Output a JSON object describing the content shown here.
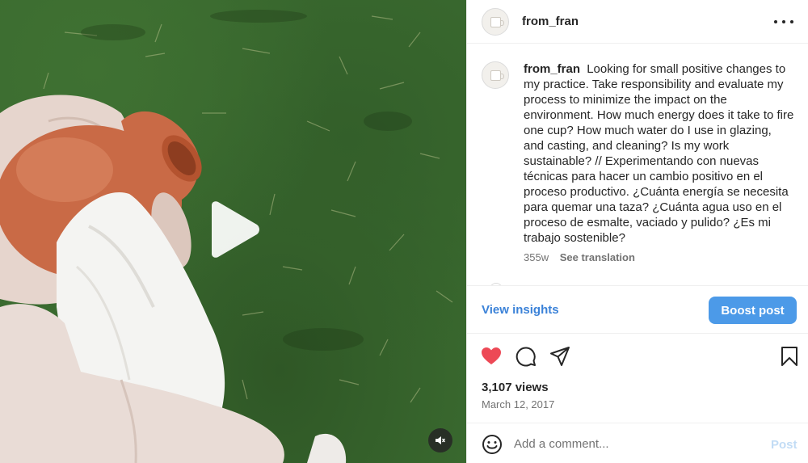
{
  "post": {
    "username": "from_fran",
    "caption": "Looking for small positive changes to my practice. Take responsibility and evaluate my process to minimize the impact on the environment. How much energy does it take to fire one cup? How much water do I use in glazing, and casting, and cleaning? Is my work sustainable? // Experimentando con nuevas técnicas para hacer un cambio positivo en el proceso productivo. ¿Cuánta energía se necesita para quemar una taza? ¿Cuánta agua uso en el proceso de esmalte, vaciado y pulido? ¿Es mi trabajo sostenible?",
    "age": "355w",
    "see_translation": "See translation",
    "views": "3,107 views",
    "date": "March 12, 2017"
  },
  "insights": {
    "view_insights": "View insights",
    "boost_post": "Boost post"
  },
  "comment": {
    "placeholder": "Add a comment...",
    "post_label": "Post"
  },
  "colors": {
    "accent": "#4c9ae8",
    "like": "#ed4956",
    "grass": "#3a6a2f",
    "terracotta": "#c96a46"
  },
  "icons": {
    "play": "play-icon",
    "mute": "muted-speaker-icon",
    "more": "more-options-icon",
    "like": "heart-icon",
    "comment": "comment-icon",
    "share": "share-icon",
    "save": "bookmark-icon",
    "emoji": "emoji-icon"
  }
}
